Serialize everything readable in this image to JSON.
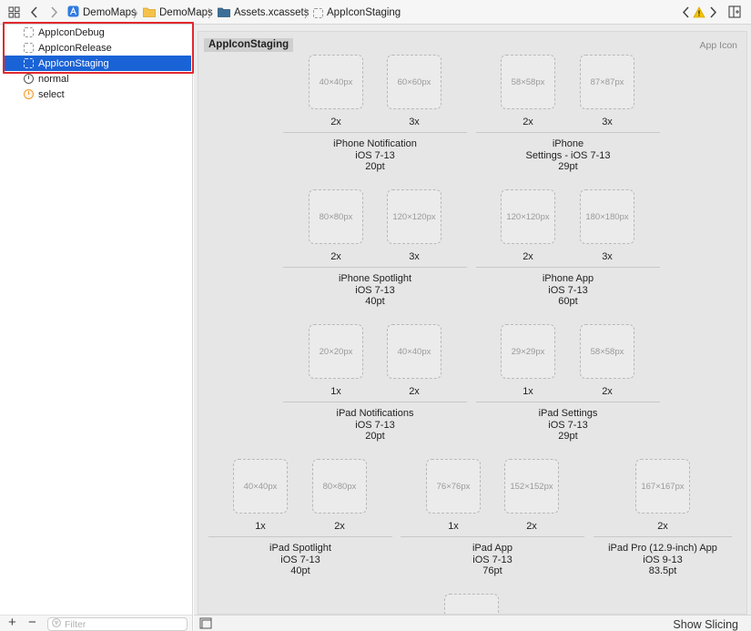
{
  "breadcrumb": {
    "project": "DemoMaps",
    "group": "DemoMaps",
    "catalog": "Assets.xcassets",
    "asset": "AppIconStaging"
  },
  "sidebar": {
    "items": [
      {
        "label": "AppIconDebug",
        "icon": "dashed-square-icon"
      },
      {
        "label": "AppIconRelease",
        "icon": "dashed-square-icon"
      },
      {
        "label": "AppIconStaging",
        "icon": "dashed-square-icon"
      },
      {
        "label": "normal",
        "icon": "color-set-icon"
      },
      {
        "label": "select",
        "icon": "color-set-icon"
      }
    ],
    "filter_placeholder": "Filter"
  },
  "asset": {
    "title": "AppIconStaging",
    "type": "App Icon",
    "groups": [
      {
        "slots": [
          {
            "size": "40×40px",
            "scale": "2x"
          },
          {
            "size": "60×60px",
            "scale": "3x"
          }
        ],
        "label": [
          "iPhone Notification",
          "iOS 7-13",
          "20pt"
        ]
      },
      {
        "slots": [
          {
            "size": "58×58px",
            "scale": "2x"
          },
          {
            "size": "87×87px",
            "scale": "3x"
          }
        ],
        "label": [
          "iPhone",
          "Settings - iOS 7-13",
          "29pt"
        ]
      },
      {
        "slots": [
          {
            "size": "80×80px",
            "scale": "2x"
          },
          {
            "size": "120×120px",
            "scale": "3x"
          }
        ],
        "label": [
          "iPhone Spotlight",
          "iOS 7-13",
          "40pt"
        ]
      },
      {
        "slots": [
          {
            "size": "120×120px",
            "scale": "2x"
          },
          {
            "size": "180×180px",
            "scale": "3x"
          }
        ],
        "label": [
          "iPhone App",
          "iOS 7-13",
          "60pt"
        ]
      },
      {
        "slots": [
          {
            "size": "20×20px",
            "scale": "1x"
          },
          {
            "size": "40×40px",
            "scale": "2x"
          }
        ],
        "label": [
          "iPad Notifications",
          "iOS 7-13",
          "20pt"
        ]
      },
      {
        "slots": [
          {
            "size": "29×29px",
            "scale": "1x"
          },
          {
            "size": "58×58px",
            "scale": "2x"
          }
        ],
        "label": [
          "iPad Settings",
          "iOS 7-13",
          "29pt"
        ]
      },
      {
        "slots": [
          {
            "size": "40×40px",
            "scale": "1x"
          },
          {
            "size": "80×80px",
            "scale": "2x"
          }
        ],
        "label": [
          "iPad Spotlight",
          "iOS 7-13",
          "40pt"
        ]
      },
      {
        "slots": [
          {
            "size": "76×76px",
            "scale": "1x"
          },
          {
            "size": "152×152px",
            "scale": "2x"
          }
        ],
        "label": [
          "iPad App",
          "iOS 7-13",
          "76pt"
        ]
      },
      {
        "slots": [
          {
            "size": "167×167px",
            "scale": "2x"
          }
        ],
        "label": [
          "iPad Pro (12.9-inch) App",
          "iOS 9-13",
          "83.5pt"
        ]
      }
    ]
  },
  "footer": {
    "show_slicing": "Show Slicing"
  },
  "colors": {
    "selection": "#1a63d6",
    "highlight": "#e0282e",
    "warning": "#f5c400"
  }
}
